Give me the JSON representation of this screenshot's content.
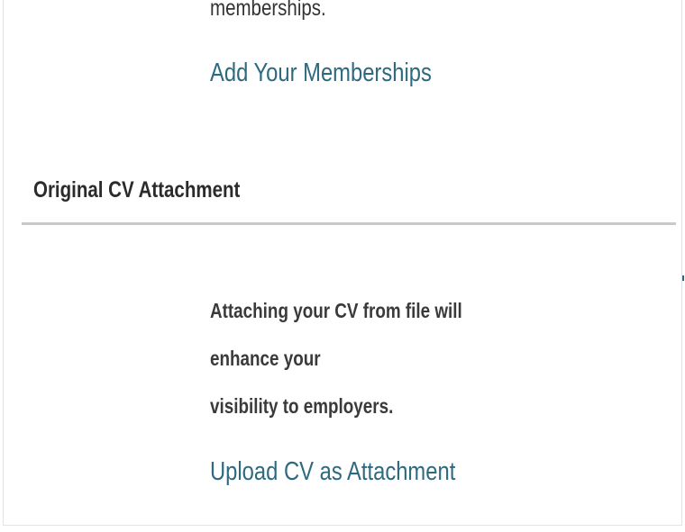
{
  "memberships": {
    "clipped_description": "memberships.",
    "add_link": "Add Your Memberships"
  },
  "cv_attachment": {
    "heading": "Original CV Attachment",
    "description_lines": [
      "Attaching your CV from file will",
      "enhance your",
      "visibility to employers."
    ],
    "upload_link": "Upload CV as Attachment"
  },
  "colors": {
    "link": "#2d6a80",
    "heading": "#2b2b2b",
    "body_text": "#3a3a3a",
    "divider": "#c9c9c9"
  }
}
